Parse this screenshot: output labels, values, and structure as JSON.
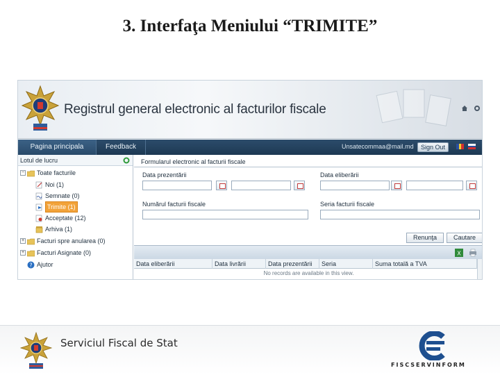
{
  "slide": {
    "title": "3. Interfaţa Meniului “TRIMITE”"
  },
  "app": {
    "title": "Registrul general electronic al facturilor fiscale",
    "nav": {
      "tab_home": "Pagina principala",
      "tab_feedback": "Feedback",
      "email": "Unsatecommaa@mail.md",
      "signout": "Sign Out"
    }
  },
  "sidebar": {
    "header": "Lotul de lucru",
    "items": [
      {
        "label": "Toate facturile"
      },
      {
        "label": "Noi (1)"
      },
      {
        "label": "Semnate (0)"
      },
      {
        "label": "Trimite (1)"
      },
      {
        "label": "Acceptate (12)"
      },
      {
        "label": "Arhiva (1)"
      },
      {
        "label": "Facturi spre anularea (0)"
      },
      {
        "label": "Facturi Asignate (0)"
      },
      {
        "label": "Ajutor"
      }
    ]
  },
  "form": {
    "header": "Formularul electronic al facturii fiscale",
    "label_date_presented": "Data prezentării",
    "label_date_delivery": "Data eliberării",
    "label_number": "Numărul facturii fiscale",
    "label_series": "Seria facturii fiscale",
    "button_reset": "Renunţa",
    "button_search": "Cautare"
  },
  "grid": {
    "columns": [
      "Data eliberării",
      "Data livrării",
      "Data prezentării",
      "Seria",
      "Suma totală a TVA"
    ],
    "empty_text": "No records are available in this view."
  },
  "footer": {
    "org": "Serviciul Fiscal de Stat",
    "brand": "FISCSERVINFORM"
  },
  "colors": {
    "nav_bg": "#1d3953",
    "selected": "#f2a33a",
    "brand_blue": "#1e4f8f"
  }
}
